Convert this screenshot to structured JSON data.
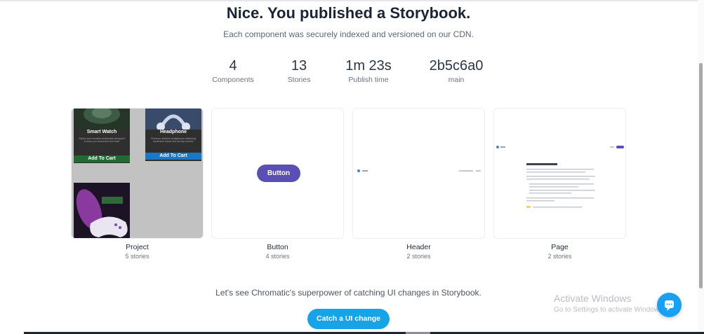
{
  "header": {
    "title": "Nice. You published a Storybook.",
    "subtitle": "Each component was securely indexed and versioned on our CDN."
  },
  "stats": [
    {
      "value": "4",
      "label": "Components"
    },
    {
      "value": "13",
      "label": "Stories"
    },
    {
      "value": "1m 23s",
      "label": "Publish time"
    },
    {
      "value": "2b5c6a0",
      "label": "main"
    }
  ],
  "cards": [
    {
      "name": "Project",
      "count": "5 stories"
    },
    {
      "name": "Button",
      "count": "4 stories"
    },
    {
      "name": "Header",
      "count": "2 stories"
    },
    {
      "name": "Page",
      "count": "2 stories"
    }
  ],
  "project_preview": {
    "products": [
      {
        "name": "Smart Watch",
        "desc": "Stylish and versatile smartwatch designed to keep you connected and track",
        "cta": "Add To Cart",
        "cta_color": "#1f6b33"
      },
      {
        "name": "Headphone",
        "desc": "Premium wireless headphones delivering immersive sound and all-day comfort.",
        "cta": "Add To Cart",
        "cta_color": "#1b78c7"
      }
    ]
  },
  "button_preview": {
    "label": "Button"
  },
  "page_preview": {
    "heading": "Pages in Storybook",
    "button": "Sign up"
  },
  "footer": {
    "text": "Let's see Chromatic's superpower of catching UI changes in Storybook.",
    "cta": "Catch a UI change"
  },
  "watermark": {
    "line1": "Activate Windows",
    "line2": "Go to Settings to activate Windows."
  },
  "colors": {
    "accent_purple": "#5a4fb4",
    "cta_blue": "#16a3e8"
  }
}
